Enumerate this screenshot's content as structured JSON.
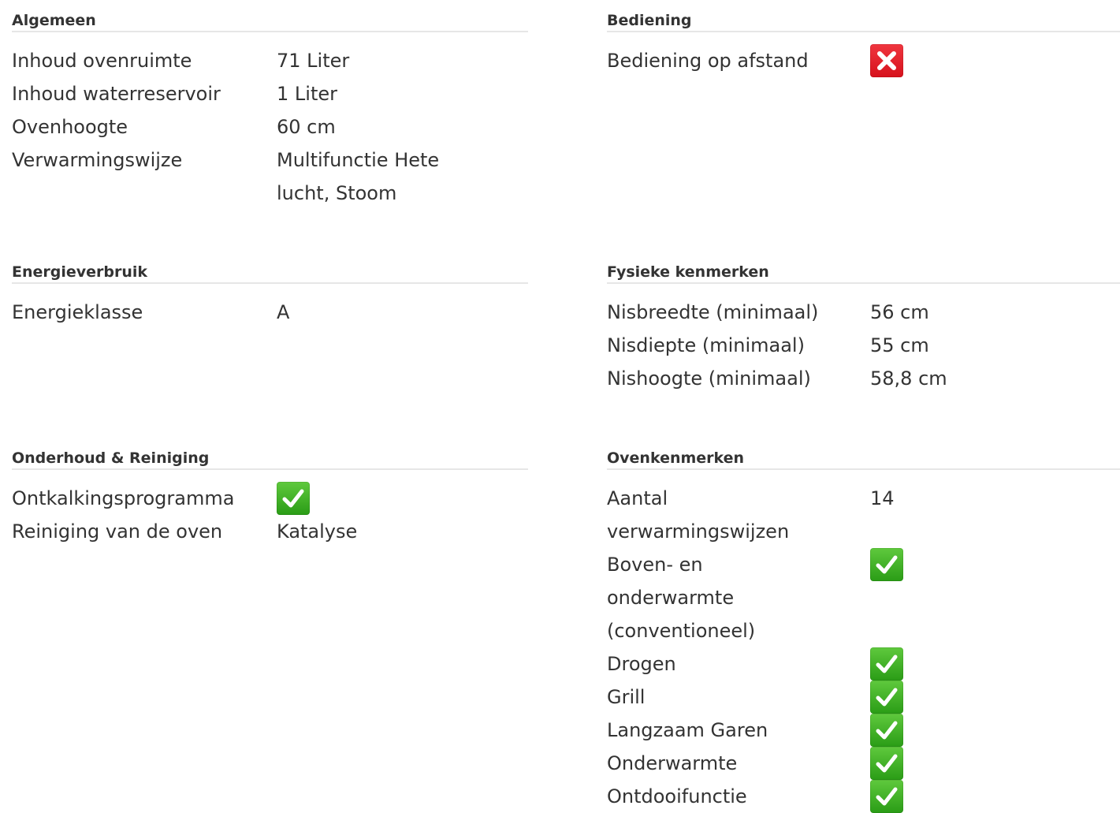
{
  "sections": {
    "algemeen": {
      "title": "Algemeen",
      "rows": [
        {
          "label": "Inhoud ovenruimte",
          "value": "71 Liter"
        },
        {
          "label": "Inhoud waterreservoir",
          "value": "1 Liter"
        },
        {
          "label": "Ovenhoogte",
          "value": "60 cm"
        },
        {
          "label": "Verwarmingswijze",
          "value": "Multifunctie Hete lucht, Stoom"
        }
      ]
    },
    "bediening": {
      "title": "Bediening",
      "rows": [
        {
          "label": "Bediening op afstand",
          "icon": "cross-icon"
        }
      ]
    },
    "energieverbruik": {
      "title": "Energieverbruik",
      "rows": [
        {
          "label": "Energieklasse",
          "value": "A"
        }
      ]
    },
    "fysieke": {
      "title": "Fysieke kenmerken",
      "rows": [
        {
          "label": "Nisbreedte (minimaal)",
          "value": "56 cm"
        },
        {
          "label": "Nisdiepte (minimaal)",
          "value": "55 cm"
        },
        {
          "label": "Nishoogte (minimaal)",
          "value": "58,8 cm"
        }
      ]
    },
    "onderhoud": {
      "title": "Onderhoud & Reiniging",
      "rows": [
        {
          "label": "Ontkalkingsprogramma",
          "icon": "check-icon"
        },
        {
          "label": "Reiniging van de oven",
          "value": "Katalyse"
        }
      ]
    },
    "ovenkenmerken": {
      "title": "Ovenkenmerken",
      "rows": [
        {
          "label": "Aantal verwarmingswijzen",
          "value": "14"
        },
        {
          "label": "Boven- en onderwarmte (conventioneel)",
          "icon": "check-icon"
        },
        {
          "label": "Drogen",
          "icon": "check-icon"
        },
        {
          "label": "Grill",
          "icon": "check-icon"
        },
        {
          "label": "Langzaam Garen",
          "icon": "check-icon"
        },
        {
          "label": "Onderwarmte",
          "icon": "check-icon"
        },
        {
          "label": "Ontdooifunctie",
          "icon": "check-icon"
        }
      ]
    }
  },
  "colors": {
    "check": "#3cb226",
    "cross": "#e31b23",
    "divider": "#e6e6e6",
    "text": "#333333"
  }
}
